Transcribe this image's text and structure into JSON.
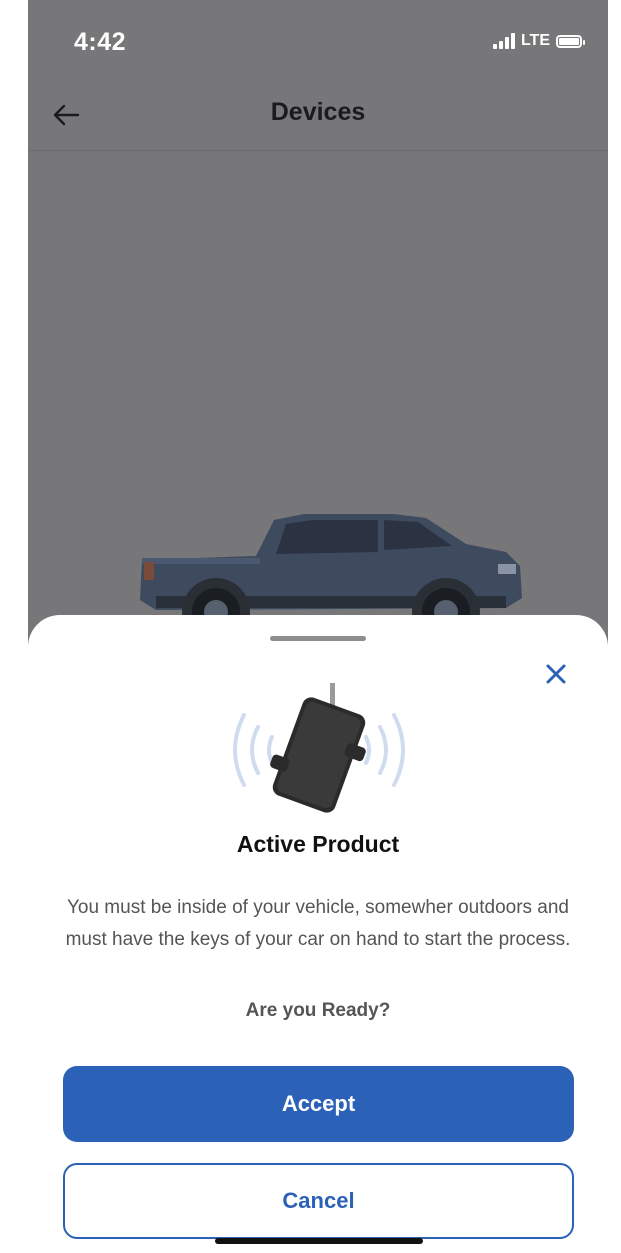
{
  "status_bar": {
    "time": "4:42",
    "network": "LTE",
    "icons": [
      "signal-icon",
      "battery-icon"
    ]
  },
  "nav": {
    "title": "Devices",
    "back_icon": "back-arrow-icon"
  },
  "sheet": {
    "close_icon": "close-icon",
    "illustration": "tracker-device-icon",
    "title": "Active Product",
    "body": "You must be inside of your vehicle, somewher outdoors and must have the keys of your car on hand to start the process.",
    "question": "Are you Ready?",
    "accept_label": "Accept",
    "cancel_label": "Cancel"
  },
  "colors": {
    "accent": "#2b62b8",
    "overlay": "#777678",
    "sheet_bg": "#ffffff"
  }
}
